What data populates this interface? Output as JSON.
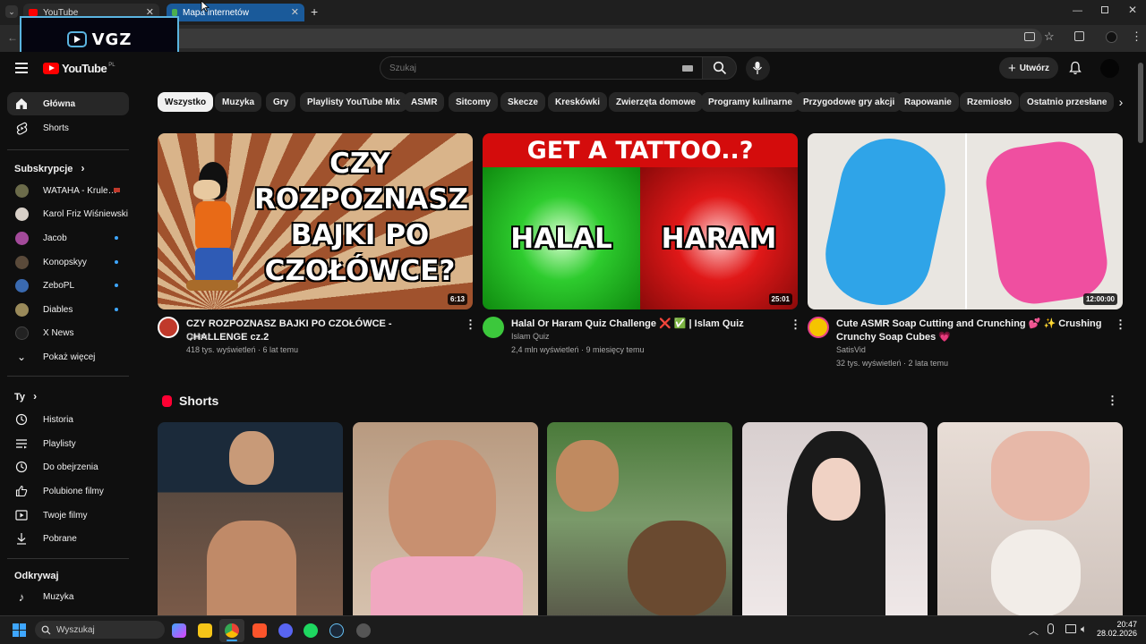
{
  "browser": {
    "tabs": [
      {
        "label": "YouTube",
        "active": false
      },
      {
        "label": "Mapa internetów",
        "active": true
      }
    ],
    "overlay_logo": "VGZ"
  },
  "youtube": {
    "logo_text": "YouTube",
    "logo_region": "PL",
    "search_placeholder": "Szukaj",
    "create_label": "Utwórz",
    "chips": [
      "Wszystko",
      "Muzyka",
      "Gry",
      "Playlisty YouTube Mix",
      "ASMR",
      "Sitcomy",
      "Skecze",
      "Kreskówki",
      "Zwierzęta domowe",
      "Programy kulinarne",
      "Przygodowe gry akcji",
      "Rapowanie",
      "Rzemiosło",
      "Ostatnio przesłane"
    ],
    "sidebar": {
      "main": [
        {
          "label": "Główna",
          "icon": "home-icon"
        },
        {
          "label": "Shorts",
          "icon": "shorts-icon"
        }
      ],
      "subscriptions_title": "Subskrypcje",
      "subscriptions": [
        {
          "label": "WATAHA - Krule…",
          "new": false,
          "color": "#6b6b4a"
        },
        {
          "label": "Karol Friz Wiśniewski",
          "new": false,
          "color": "#d8d0c8"
        },
        {
          "label": "Jacob",
          "new": true,
          "color": "#a34a9a"
        },
        {
          "label": "Konopskyy",
          "new": true,
          "color": "#5a4a3a"
        },
        {
          "label": "ZeboPL",
          "new": true,
          "color": "#3a6ab0"
        },
        {
          "label": "Diables",
          "new": true,
          "color": "#9a8a5a"
        },
        {
          "label": "X News",
          "new": false,
          "color": "#222222"
        }
      ],
      "show_more": "Pokaż więcej",
      "you_title": "Ty",
      "you": [
        {
          "label": "Historia",
          "icon": "history-icon"
        },
        {
          "label": "Playlisty",
          "icon": "playlist-icon"
        },
        {
          "label": "Do obejrzenia",
          "icon": "clock-icon"
        },
        {
          "label": "Polubione filmy",
          "icon": "thumbs-up-icon"
        },
        {
          "label": "Twoje filmy",
          "icon": "video-icon"
        },
        {
          "label": "Pobrane",
          "icon": "download-icon"
        }
      ],
      "explore_title": "Odkrywaj",
      "explore": [
        {
          "label": "Muzyka",
          "icon": "music-icon"
        }
      ]
    },
    "videos": [
      {
        "title": "CZY ROZPOZNASZ BAJKI PO CZOŁÓWCE  - CHALLENGE cz.2",
        "channel": "Quizuz",
        "meta": "418 tys. wyświetleń · 6 lat temu",
        "duration": "6:13",
        "thumb_text": "CZY ROZPOZNASZ BAJKI PO CZOŁÓWCE?"
      },
      {
        "title": "Halal Or Haram Quiz Challenge ❌ ✅ | Islam Quiz",
        "channel": "Islam Quiz",
        "meta": "2,4 mln wyświetleń · 9 miesięcy temu",
        "duration": "25:01",
        "thumb_top": "GET A TATTOO..?",
        "thumb_left": "HALAL",
        "thumb_right": "HARAM"
      },
      {
        "title": "Cute ASMR Soap Cutting and Crunching 💕 ✨ Crushing Crunchy Soap Cubes 💗",
        "channel": "SatisVid",
        "meta": "32 tys. wyświetleń · 2 lata temu",
        "duration": "12:00:00"
      }
    ],
    "shorts_title": "Shorts"
  },
  "taskbar": {
    "search_placeholder": "Wyszukaj",
    "time": "20:47",
    "date": "28.02.2026"
  }
}
